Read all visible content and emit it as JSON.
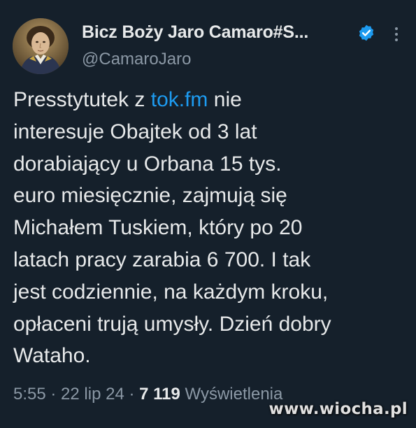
{
  "author": {
    "name": "Bicz Boży Jaro Camaro#S...",
    "handle": "@CamaroJaro",
    "verified": true,
    "avatar_icon": "portrait-avatar"
  },
  "tweet": {
    "lines": [
      {
        "before": "Presstytutek z ",
        "link": "tok.fm",
        "after": " nie"
      },
      {
        "text": "interesuje Obajtek od 3 lat"
      },
      {
        "text": "dorabiający u Orbana 15 tys."
      },
      {
        "text": "euro miesięcznie, zajmują się"
      },
      {
        "text": "Michałem Tuskiem, który po 20"
      },
      {
        "text": "latach pracy zarabia 6 700. I tak"
      },
      {
        "text": "jest codziennie, na każdym kroku,"
      },
      {
        "text": "opłaceni trują umysły. Dzień dobry"
      },
      {
        "text": "Wataho."
      }
    ]
  },
  "meta": {
    "time": "5:55",
    "sep1": " · ",
    "date": "22 lip 24",
    "sep2": " · ",
    "views_count": "7 119",
    "views_label": " Wyświetlenia"
  },
  "watermark": "www.wiocha.pl",
  "colors": {
    "background": "#15202b",
    "text": "#e7e9ea",
    "secondary": "#8b98a5",
    "link": "#1d9bf0",
    "verified_badge": "#1d9bf0"
  }
}
